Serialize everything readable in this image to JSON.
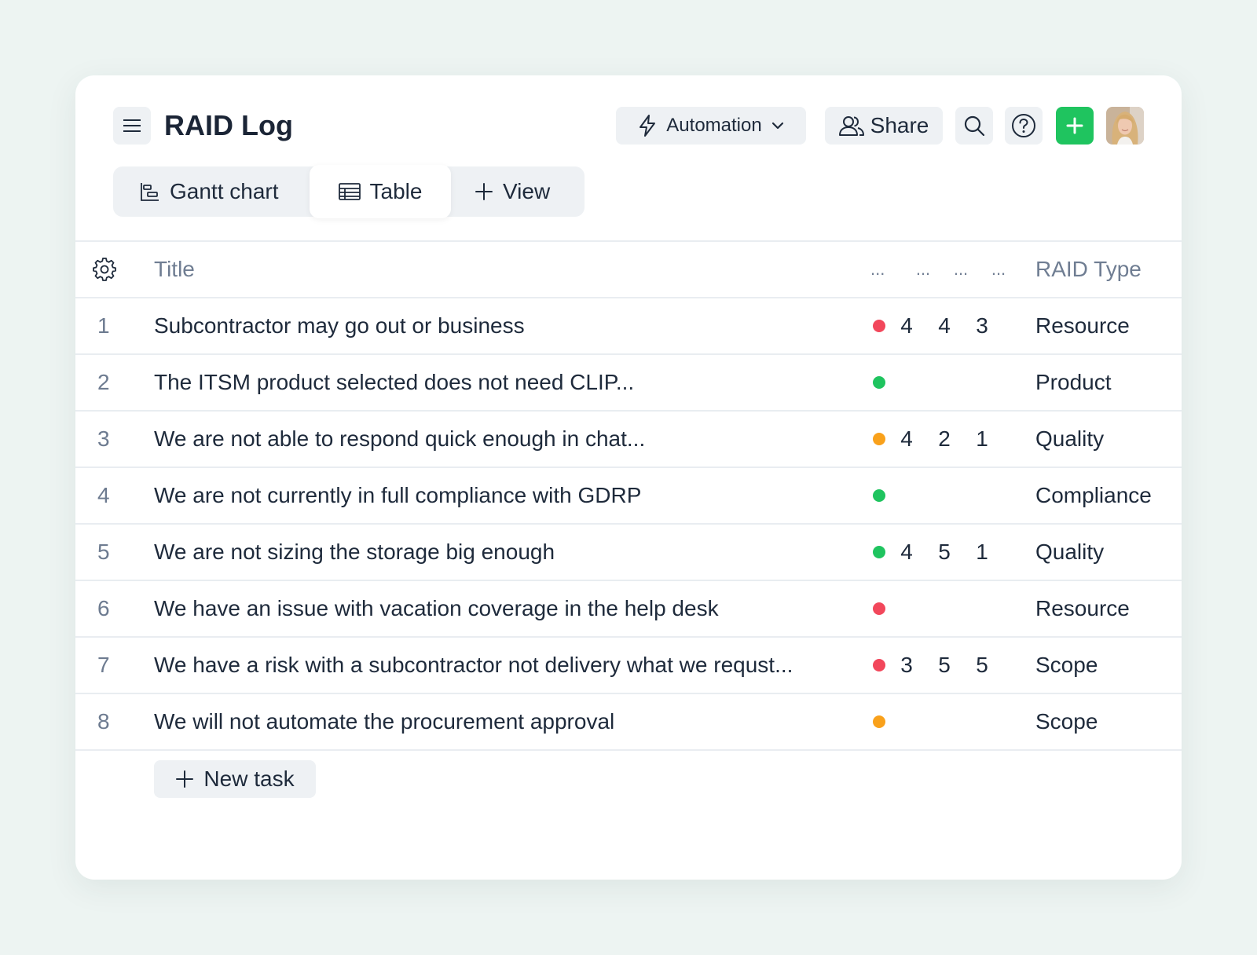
{
  "header": {
    "title": "RAID Log",
    "automation_label": "Automation",
    "share_label": "Share"
  },
  "tabs": [
    {
      "label": "Gantt chart",
      "active": false
    },
    {
      "label": "Table",
      "active": true
    },
    {
      "label": "View",
      "active": false
    }
  ],
  "table": {
    "headers": {
      "title": "Title",
      "status": "...",
      "col_a": "...",
      "col_b": "...",
      "col_c": "...",
      "raid_type": "RAID Type"
    },
    "rows": [
      {
        "num": "1",
        "title": "Subcontractor may go out or business",
        "status": "#f2475b",
        "a": "4",
        "b": "4",
        "c": "3",
        "type": "Resource"
      },
      {
        "num": "2",
        "title": "The ITSM product selected does not need CLIP...",
        "status": "#1fc45f",
        "a": "",
        "b": "",
        "c": "",
        "type": "Product"
      },
      {
        "num": "3",
        "title": "We are not able to respond quick enough in chat...",
        "status": "#f9a11b",
        "a": "4",
        "b": "2",
        "c": "1",
        "type": "Quality"
      },
      {
        "num": "4",
        "title": "We are not currently in full compliance with GDRP",
        "status": "#1fc45f",
        "a": "",
        "b": "",
        "c": "",
        "type": "Compliance"
      },
      {
        "num": "5",
        "title": "We are not sizing the storage big enough",
        "status": "#1fc45f",
        "a": "4",
        "b": "5",
        "c": "1",
        "type": "Quality"
      },
      {
        "num": "6",
        "title": "We have an issue with vacation coverage in the help desk",
        "status": "#f2475b",
        "a": "",
        "b": "",
        "c": "",
        "type": "Resource"
      },
      {
        "num": "7",
        "title": "We have a risk with a subcontractor not delivery what we requst...",
        "status": "#f2475b",
        "a": "3",
        "b": "5",
        "c": "5",
        "type": "Scope"
      },
      {
        "num": "8",
        "title": "We will not automate the procurement approval",
        "status": "#f9a11b",
        "a": "",
        "b": "",
        "c": "",
        "type": "Scope"
      }
    ],
    "new_task_label": "New task"
  },
  "colors": {
    "accent_green": "#1fc45f",
    "status_red": "#f2475b",
    "status_green": "#1fc45f",
    "status_orange": "#f9a11b"
  },
  "icons": [
    "menu-icon",
    "bolt-icon",
    "chevron-down-icon",
    "users-icon",
    "search-icon",
    "help-icon",
    "plus-icon",
    "gantt-icon",
    "table-icon",
    "gear-icon"
  ]
}
